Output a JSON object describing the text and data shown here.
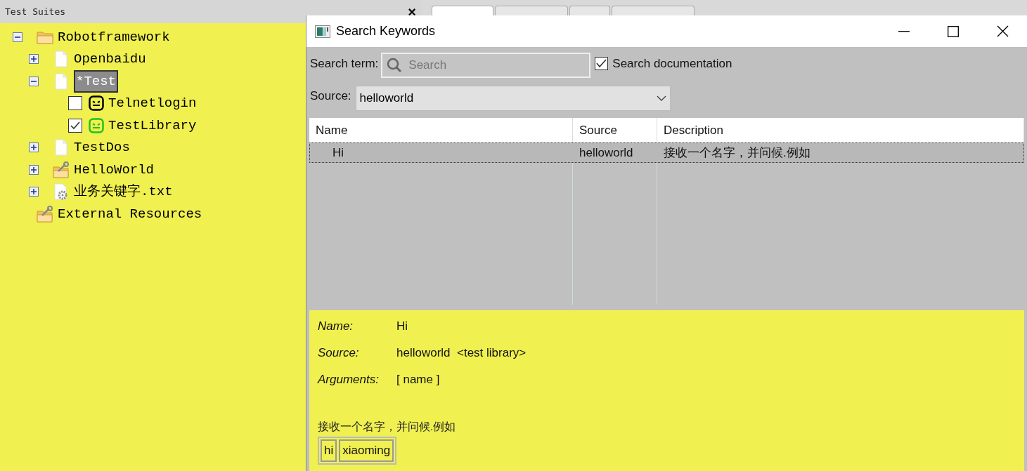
{
  "panel": {
    "title": "Test Suites",
    "close": "×"
  },
  "tree": [
    {
      "label": "Robotframework",
      "kind": "folder",
      "expanded": true,
      "selected": false,
      "children": [
        {
          "label": "Openbaidu",
          "kind": "file",
          "expanded": false,
          "selected": false
        },
        {
          "label": "*Test",
          "kind": "file",
          "expanded": true,
          "selected": true,
          "children": [
            {
              "label": "Telnetlogin",
              "kind": "keyword",
              "checked": false,
              "selected": false,
              "color": "#000000"
            },
            {
              "label": "TestLibrary",
              "kind": "keyword",
              "checked": true,
              "selected": false,
              "color": "#22c022"
            }
          ]
        },
        {
          "label": "TestDos",
          "kind": "file",
          "expanded": false,
          "selected": false
        },
        {
          "label": "HelloWorld",
          "kind": "resource-folder",
          "expanded": false,
          "selected": false
        },
        {
          "label": "业务关键字.txt",
          "kind": "resource-file",
          "expanded": false,
          "selected": false
        }
      ]
    },
    {
      "label": "External Resources",
      "kind": "resource-folder",
      "selected": false
    }
  ],
  "editor_tabs": [
    {
      "selected": true
    },
    {
      "selected": false
    },
    {
      "selected": false
    },
    {
      "selected": false
    }
  ],
  "dialog": {
    "title": "Search Keywords",
    "search_label": "Search term:",
    "search": {
      "placeholder": "Search"
    },
    "doc_checkbox": {
      "label": "Search documentation",
      "checked": true
    },
    "source_label": "Source:",
    "source_value": "helloworld",
    "table": {
      "columns": [
        "Name",
        "Source",
        "Description"
      ],
      "rows": [
        {
          "cells": [
            "Hi",
            "helloworld",
            "接收一个名字，并问候.例如"
          ],
          "selected": true
        }
      ]
    },
    "details": {
      "fields": [
        {
          "label": "Name:",
          "value": "Hi"
        },
        {
          "label": "Source:",
          "value": "helloworld  <test library>"
        },
        {
          "label": "Arguments:",
          "value": "[ name ]"
        }
      ],
      "description": "接收一个名字，并问候.例如",
      "example": [
        "hi",
        "xiaoming"
      ]
    }
  }
}
